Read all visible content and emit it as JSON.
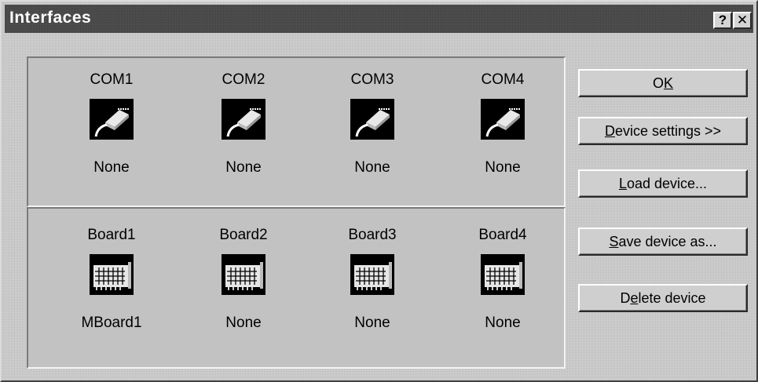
{
  "window": {
    "title": "Interfaces",
    "help_glyph": "?",
    "close_glyph": "✕"
  },
  "com_ports": [
    {
      "name": "COM1",
      "status": "None",
      "icon": "serial-cable-icon"
    },
    {
      "name": "COM2",
      "status": "None",
      "icon": "serial-cable-icon"
    },
    {
      "name": "COM3",
      "status": "None",
      "icon": "serial-cable-icon"
    },
    {
      "name": "COM4",
      "status": "None",
      "icon": "serial-cable-icon"
    }
  ],
  "boards": [
    {
      "name": "Board1",
      "status": "MBoard1",
      "icon": "interface-card-icon"
    },
    {
      "name": "Board2",
      "status": "None",
      "icon": "interface-card-icon"
    },
    {
      "name": "Board3",
      "status": "None",
      "icon": "interface-card-icon"
    },
    {
      "name": "Board4",
      "status": "None",
      "icon": "interface-card-icon"
    }
  ],
  "buttons": {
    "ok": {
      "before": "O",
      "accel": "K",
      "after": ""
    },
    "device_settings": {
      "before": "",
      "accel": "D",
      "after": "evice settings >>"
    },
    "load_device": {
      "before": "",
      "accel": "L",
      "after": "oad device..."
    },
    "save_device_as": {
      "before": "",
      "accel": "S",
      "after": "ave device as..."
    },
    "delete_device": {
      "before": "D",
      "accel": "e",
      "after": "lete device"
    }
  }
}
